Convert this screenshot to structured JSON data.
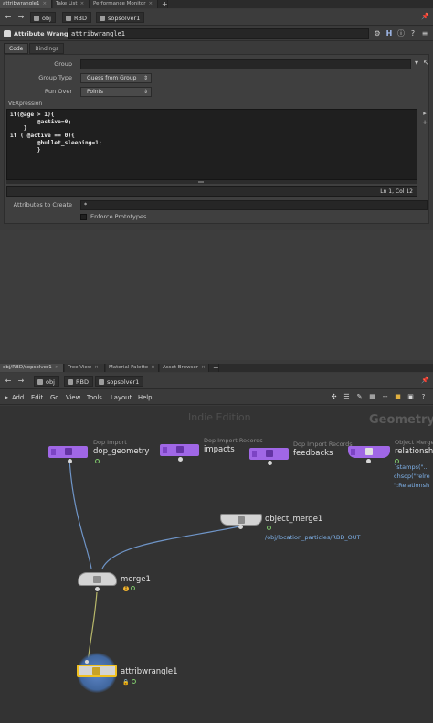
{
  "top_tabs": [
    "attribwrangle1",
    "Take List",
    "Performance Monitor"
  ],
  "top_path": [
    "obj",
    "RBD",
    "sopsolver1"
  ],
  "node_header": {
    "type_label": "Attribute Wrangle",
    "node_name": "attribwrangle1",
    "icons": [
      "gear-icon",
      "help-icon",
      "info-icon",
      "help-alt-icon",
      "menu-icon"
    ]
  },
  "sub_tabs": [
    "Code",
    "Bindings"
  ],
  "parms": {
    "group_label": "Group",
    "group_value": "",
    "group_type_label": "Group Type",
    "group_type_value": "Guess from Group",
    "run_over_label": "Run Over",
    "run_over_value": "Points",
    "vex_label": "VEXpression",
    "code": "if(@age > 1){\n        @active=0;\n    }\nif ( @active == 0){\n        @bullet_sleeping=1;\n        }",
    "cursor_pos": "Ln 1, Col 12",
    "attrs_label": "Attributes to Create",
    "attrs_value": "*",
    "enforce_label": "Enforce Prototypes"
  },
  "bottom_tabs": [
    "obj/RBD/sopsolver1",
    "Tree View",
    "Material Palette",
    "Asset Browser"
  ],
  "bottom_path": [
    "obj",
    "RBD",
    "sopsolver1"
  ],
  "menu": [
    "Add",
    "Edit",
    "Go",
    "View",
    "Tools",
    "Layout",
    "Help"
  ],
  "network": {
    "watermark": "Indie Edition",
    "context_title": "Geometry",
    "nodes": {
      "dop_geometry": {
        "type": "Dop Import",
        "name": "dop_geometry"
      },
      "impacts": {
        "type": "Dop Import Records",
        "name": "impacts"
      },
      "feedbacks": {
        "type": "Dop Import Records",
        "name": "feedbacks"
      },
      "relationships": {
        "type": "Object Merge",
        "name": "relationsh"
      },
      "object_merge1": {
        "name": "object_merge1",
        "path": "/obj/location_particles/RBD_OUT"
      },
      "merge1": {
        "name": "merge1"
      },
      "attribwrangle1": {
        "name": "attribwrangle1"
      }
    },
    "side_text": [
      "`stamps(\"...",
      "chsop(\"relre",
      "\":Relationsh"
    ]
  },
  "colors": {
    "dop_node": "#a067e6",
    "link_blue": "#6f95c8",
    "link_yellow": "#b8b86a",
    "selected": "#f0c020"
  }
}
